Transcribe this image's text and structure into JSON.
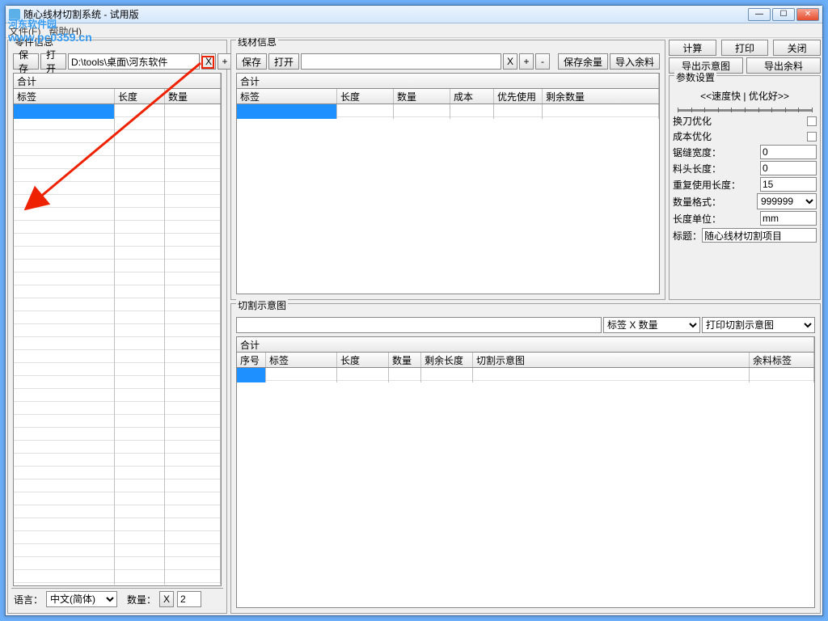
{
  "window": {
    "title": "随心线材切割系统 - 试用版"
  },
  "menu": {
    "file": "文件(F)",
    "help": "帮助(H)"
  },
  "left": {
    "group": "零件信息",
    "save": "保存",
    "open": "打开",
    "path": "D:\\tools\\桌面\\河东软件",
    "x": "X",
    "plus": "+",
    "minus": "-",
    "sum": "合计",
    "cols": {
      "label": "标签",
      "length": "长度",
      "qty": "数量"
    },
    "lang_label": "语言：",
    "lang_value": "中文(简体)",
    "qty_label": "数量：",
    "qty_x": "X",
    "qty_val": "2"
  },
  "mat": {
    "group": "线材信息",
    "save": "保存",
    "open": "打开",
    "x": "X",
    "plus": "+",
    "minus": "-",
    "save_rem": "保存余量",
    "import_rem": "导入余料",
    "sum": "合计",
    "cols": {
      "label": "标签",
      "length": "长度",
      "qty": "数量",
      "cost": "成本",
      "prio": "优先使用",
      "remain": "剩余数量"
    }
  },
  "actions": {
    "calc": "计算",
    "print": "打印",
    "close": "关闭",
    "export_diag": "导出示意图",
    "export_rem": "导出余料"
  },
  "params": {
    "group": "参数设置",
    "slider": "<<速度快 | 优化好>>",
    "knife": "换刀优化",
    "cost": "成本优化",
    "kerf": "锯缝宽度：",
    "kerf_v": "0",
    "head": "料头长度：",
    "head_v": "0",
    "reuse": "重复使用长度：",
    "reuse_v": "15",
    "fmt": "数量格式：",
    "fmt_v": "999999",
    "unit": "长度单位：",
    "unit_v": "mm",
    "title": "标题：",
    "title_v": "随心线材切割项目"
  },
  "cut": {
    "group": "切割示意图",
    "dd1": "标签 X 数量",
    "dd2": "打印切割示意图",
    "sum": "合计",
    "cols": {
      "no": "序号",
      "label": "标签",
      "length": "长度",
      "qty": "数量",
      "remlen": "剩余长度",
      "diagram": "切割示意图",
      "remlabel": "余料标签"
    }
  },
  "watermark": {
    "name": "河东软件园",
    "url": "www.pc0359.cn"
  }
}
